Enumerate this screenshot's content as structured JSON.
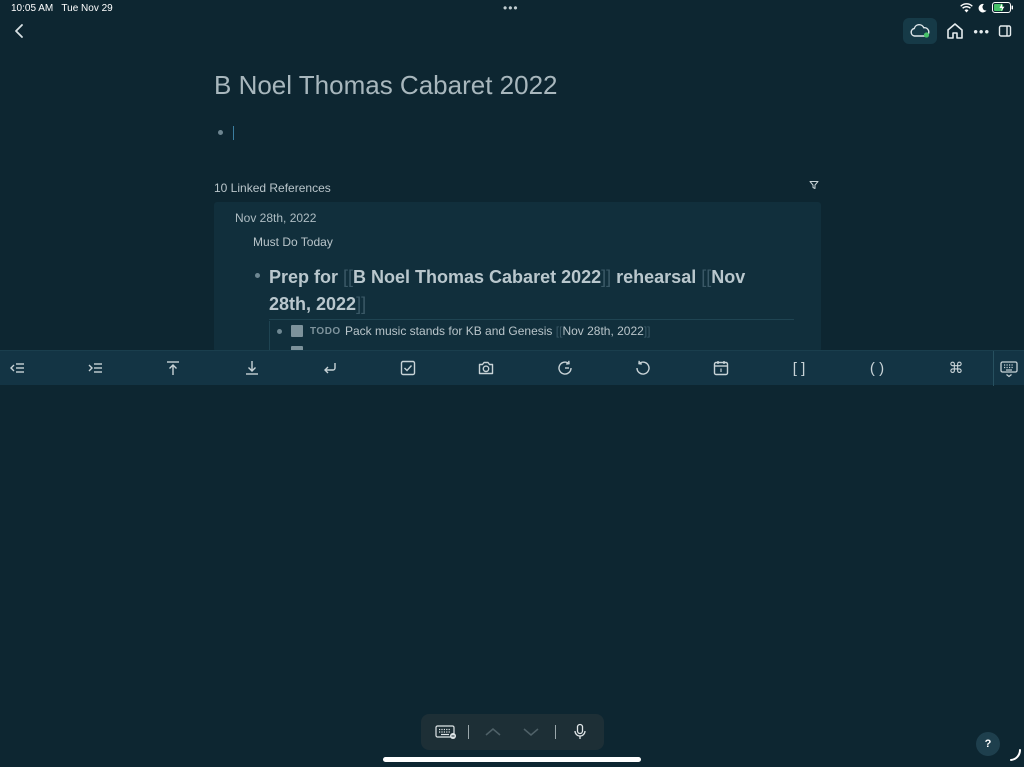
{
  "status": {
    "time": "10:05 AM",
    "date": "Tue Nov 29",
    "multitask_dots": "•••",
    "icons": [
      "wifi-icon",
      "moon-icon",
      "battery-charging-icon"
    ]
  },
  "nav": {
    "back_icon": "chevron-left-icon",
    "actions": [
      "cloud-sync-icon",
      "home-icon",
      "more-icon",
      "sidebar-toggle-icon"
    ],
    "more_label": "•••"
  },
  "page": {
    "title": "B Noel Thomas Cabaret 2022"
  },
  "references": {
    "count_label": "10 Linked References",
    "filter_icon": "filter-icon",
    "date": "Nov 28th, 2022",
    "parent": "Must Do Today",
    "block": {
      "prefix": "Prep for ",
      "link1": "B Noel Thomas Cabaret 2022",
      "middle": " rehearsal ",
      "link2_part1": "Nov",
      "link2_part2": "28th, 2022",
      "open_bracket": "[[",
      "close_bracket": "]]"
    },
    "child": {
      "marker": "TODO",
      "text": "Pack music stands for KB and Genesis ",
      "link": "Nov 28th, 2022"
    }
  },
  "toolbar": {
    "items": [
      "outdent-icon",
      "indent-icon",
      "move-up-icon",
      "move-down-icon",
      "new-line-icon",
      "todo-icon",
      "camera-icon",
      "redo-icon",
      "undo-icon",
      "calendar-icon",
      "brackets-icon",
      "parens-icon",
      "command-icon",
      "hide-keyboard-icon"
    ],
    "brackets_label": "[ ]",
    "parens_label": "( )",
    "command_label": "⌘"
  },
  "help": {
    "label": "?"
  },
  "accent_color": "#47c169",
  "background_color": "#0d2631"
}
